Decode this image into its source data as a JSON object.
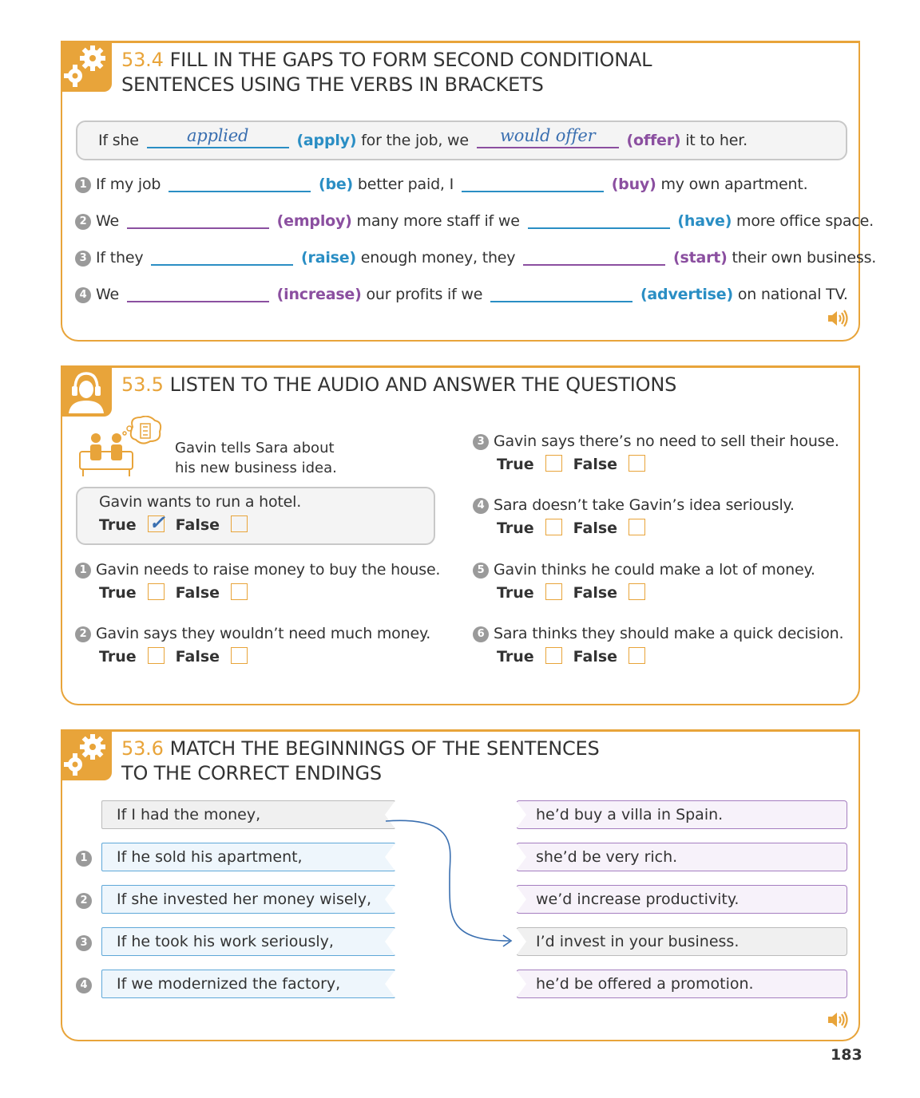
{
  "colors": {
    "accent": "#e8a43a",
    "blue": "#2a8ec4",
    "purple": "#8b4fa0"
  },
  "s534": {
    "num": "53.4",
    "title1": "FILL IN THE GAPS TO FORM SECOND CONDITIONAL",
    "title2": "SENTENCES USING THE VERBS IN BRACKETS",
    "example": {
      "a": "If she",
      "g1": "applied",
      "v1": "(apply)",
      "b": "for the job, we",
      "g2": "would offer",
      "v2": "(offer)",
      "c": "it to her."
    },
    "items": [
      {
        "n": "1",
        "a": "If my job",
        "v1": "(be)",
        "b": "better paid, I",
        "v2": "(buy)",
        "c": "my own apartment."
      },
      {
        "n": "2",
        "a": "We",
        "v1": "(employ)",
        "b": "many more staff if we",
        "v2": "(have)",
        "c": "more office space."
      },
      {
        "n": "3",
        "a": "If they",
        "v1": "(raise)",
        "b": "enough money, they",
        "v2": "(start)",
        "c": "their own business."
      },
      {
        "n": "4",
        "a": "We",
        "v1": "(increase)",
        "b": "our profits if we",
        "v2": "(advertise)",
        "c": "on national TV."
      }
    ]
  },
  "s535": {
    "num": "53.5",
    "title": "LISTEN TO THE AUDIO AND ANSWER THE QUESTIONS",
    "intro1": "Gavin tells Sara about",
    "intro2": "his new business idea.",
    "true_label": "True",
    "false_label": "False",
    "example": {
      "q": "Gavin wants to run a hotel.",
      "answer": "True"
    },
    "items": [
      {
        "n": "1",
        "q": "Gavin needs to raise money to buy the house."
      },
      {
        "n": "2",
        "q": "Gavin says they wouldn’t need much money."
      },
      {
        "n": "3",
        "q": "Gavin says there’s no need to sell their house."
      },
      {
        "n": "4",
        "q": "Sara doesn’t take Gavin’s idea seriously."
      },
      {
        "n": "5",
        "q": "Gavin thinks he could make a lot of money."
      },
      {
        "n": "6",
        "q": "Sara thinks they should make a quick decision."
      }
    ]
  },
  "s536": {
    "num": "53.6",
    "title1": "MATCH THE BEGINNINGS OF THE SENTENCES",
    "title2": "TO THE CORRECT ENDINGS",
    "left": [
      {
        "n": "",
        "t": "If I had the money,"
      },
      {
        "n": "1",
        "t": "If he sold his apartment,"
      },
      {
        "n": "2",
        "t": "If she invested her money wisely,"
      },
      {
        "n": "3",
        "t": "If he took his work seriously,"
      },
      {
        "n": "4",
        "t": "If we modernized the factory,"
      }
    ],
    "right": [
      "he’d buy a villa in Spain.",
      "she’d be very rich.",
      "we’d increase productivity.",
      "I’d invest in your business.",
      "he’d be offered a promotion."
    ]
  },
  "page_number": "183"
}
